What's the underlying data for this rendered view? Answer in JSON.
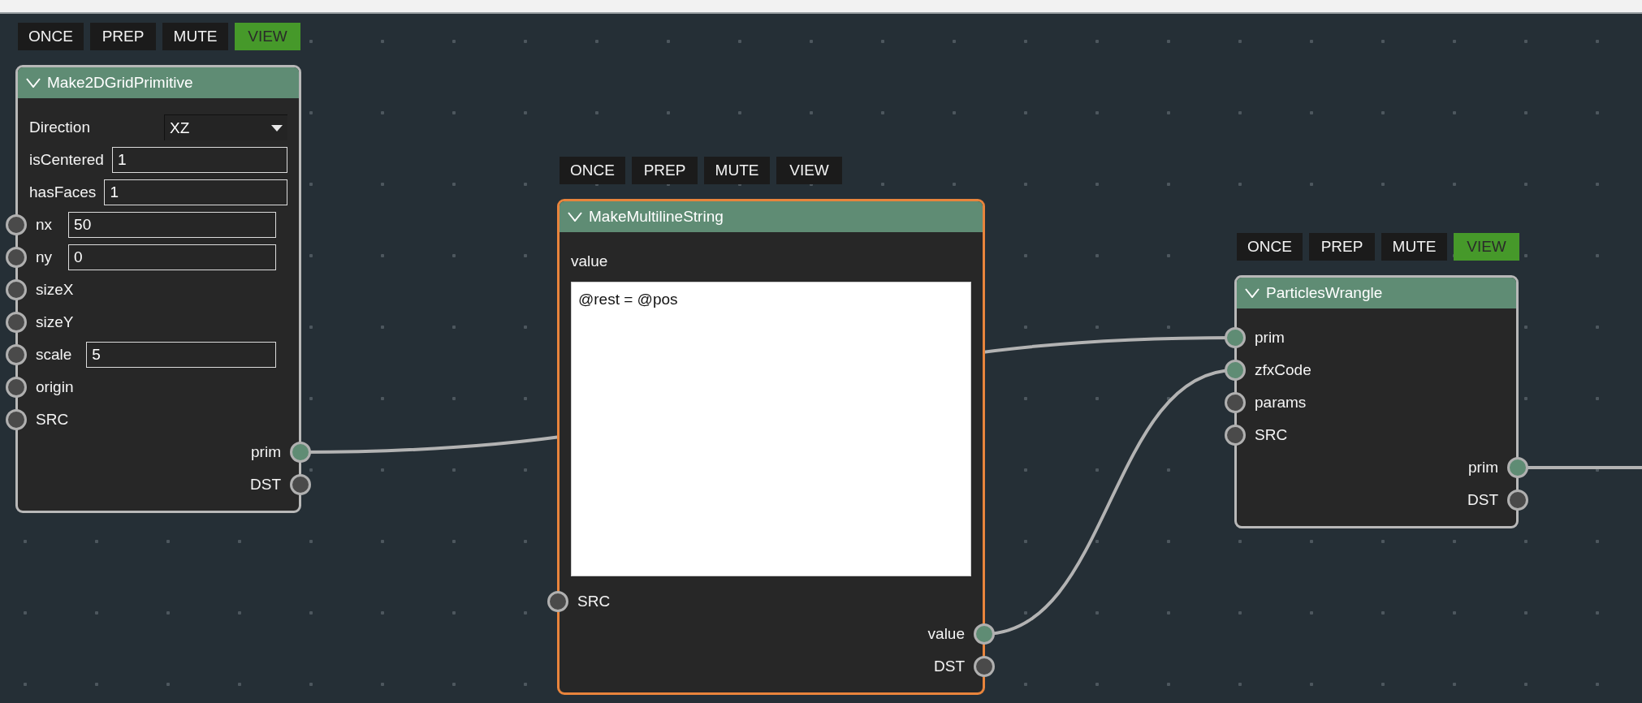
{
  "nodes": [
    {
      "title": "Make2DGridPrimitive",
      "selected": false,
      "toggles": [
        {
          "label": "ONCE",
          "on": false
        },
        {
          "label": "PREP",
          "on": false
        },
        {
          "label": "MUTE",
          "on": false
        },
        {
          "label": "VIEW",
          "on": true
        }
      ],
      "inputs": [
        {
          "kind": "dropdown",
          "name": "Direction",
          "value": "XZ"
        },
        {
          "kind": "field",
          "name": "isCentered",
          "value": "1"
        },
        {
          "kind": "field",
          "name": "hasFaces",
          "value": "1"
        },
        {
          "kind": "socket",
          "name": "nx",
          "value": "50",
          "connected": false
        },
        {
          "kind": "socket",
          "name": "ny",
          "value": "0",
          "connected": false
        },
        {
          "kind": "socket",
          "name": "sizeX",
          "connected": false
        },
        {
          "kind": "socket",
          "name": "sizeY",
          "connected": false
        },
        {
          "kind": "socket",
          "name": "scale",
          "value": "5",
          "connected": false
        },
        {
          "kind": "socket",
          "name": "origin",
          "connected": false
        },
        {
          "kind": "socket",
          "name": "SRC",
          "connected": false
        }
      ],
      "outputs": [
        {
          "name": "prim",
          "connected": true
        },
        {
          "name": "DST",
          "connected": false
        }
      ]
    },
    {
      "title": "MakeMultilineString",
      "selected": true,
      "toggles": [
        {
          "label": "ONCE",
          "on": false
        },
        {
          "label": "PREP",
          "on": false
        },
        {
          "label": "MUTE",
          "on": false
        },
        {
          "label": "VIEW",
          "on": false
        }
      ],
      "inputs": [
        {
          "kind": "text",
          "name": "value",
          "value": "@rest = @pos"
        },
        {
          "kind": "socket",
          "name": "SRC",
          "connected": false
        }
      ],
      "outputs": [
        {
          "name": "value",
          "connected": true
        },
        {
          "name": "DST",
          "connected": false
        }
      ]
    },
    {
      "title": "ParticlesWrangle",
      "selected": false,
      "toggles": [
        {
          "label": "ONCE",
          "on": false
        },
        {
          "label": "PREP",
          "on": false
        },
        {
          "label": "MUTE",
          "on": false
        },
        {
          "label": "VIEW",
          "on": true
        }
      ],
      "inputs": [
        {
          "kind": "socket",
          "name": "prim",
          "connected": true
        },
        {
          "kind": "socket",
          "name": "zfxCode",
          "connected": true
        },
        {
          "kind": "socket",
          "name": "params",
          "connected": false
        },
        {
          "kind": "socket",
          "name": "SRC",
          "connected": false
        }
      ],
      "outputs": [
        {
          "name": "prim",
          "connected": true
        },
        {
          "name": "DST",
          "connected": false
        }
      ]
    }
  ]
}
